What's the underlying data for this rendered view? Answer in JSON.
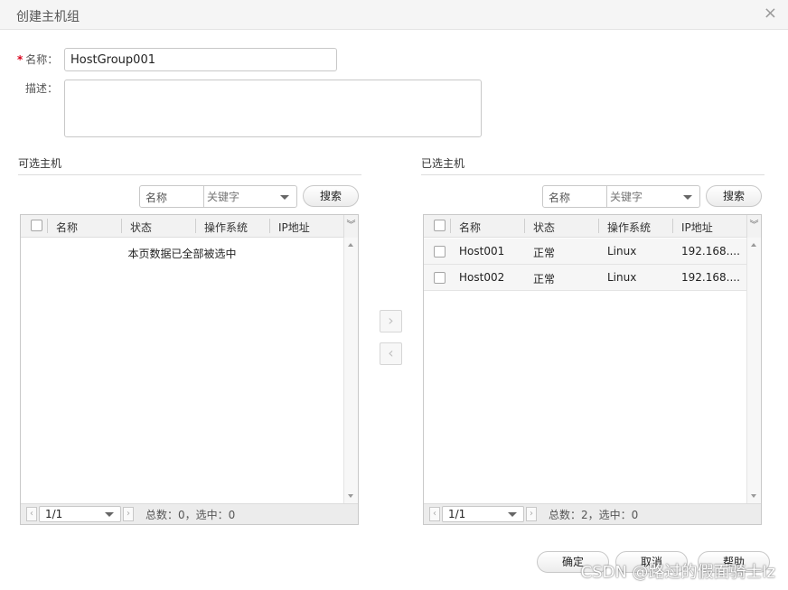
{
  "dialog": {
    "title": "创建主机组",
    "close_icon": "×"
  },
  "form": {
    "required_mark": "*",
    "name_label": "名称：",
    "name_value": "HostGroup001",
    "desc_label": "描述：",
    "desc_value": ""
  },
  "available": {
    "title": "可选主机",
    "search_field": "名称",
    "search_placeholder": "关键字",
    "search_button": "搜索",
    "columns": [
      "名称",
      "状态",
      "操作系统",
      "IP地址"
    ],
    "empty_text": "本页数据已全部被选中",
    "page": "1/1",
    "summary": "总数：0，选中：0"
  },
  "selected": {
    "title": "已选主机",
    "search_field": "名称",
    "search_placeholder": "关键字",
    "search_button": "搜索",
    "columns": [
      "名称",
      "状态",
      "操作系统",
      "IP地址"
    ],
    "rows": [
      {
        "name": "Host001",
        "status": "正常",
        "os": "Linux",
        "ip": "192.168...."
      },
      {
        "name": "Host002",
        "status": "正常",
        "os": "Linux",
        "ip": "192.168...."
      }
    ],
    "page": "1/1",
    "summary": "总数：2，选中：0"
  },
  "move": {
    "right_icon": "›",
    "left_icon": "‹"
  },
  "footer": {
    "ok": "确定",
    "cancel": "取消",
    "help": "帮助"
  },
  "watermark": "CSDN @路过的假面骑士lz"
}
